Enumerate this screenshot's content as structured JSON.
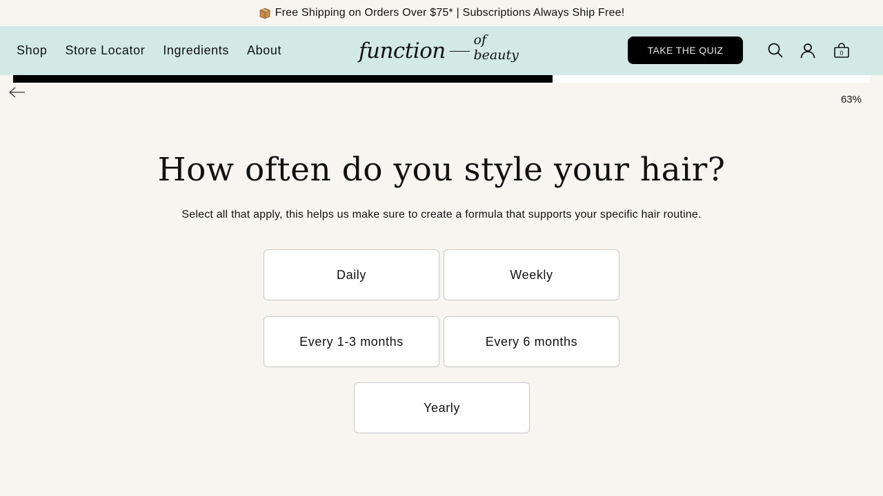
{
  "announcement": {
    "icon": "package-icon",
    "text": "Free Shipping on Orders Over $75* | Subscriptions Always Ship Free!"
  },
  "nav": {
    "links": [
      "Shop",
      "Store Locator",
      "Ingredients",
      "About"
    ],
    "logo_main": "function",
    "logo_sub": "of beauty",
    "quiz_button": "TAKE THE QUIZ",
    "cart_count": "0",
    "icons": [
      "search-icon",
      "account-icon",
      "cart-icon"
    ],
    "background": "#d3e9e6"
  },
  "progress": {
    "percent": 63,
    "label": "63%"
  },
  "question": {
    "title": "How often do you style your hair?",
    "subtitle": "Select all that apply, this helps us make sure to create a formula that supports your specific hair routine.",
    "options": [
      "Daily",
      "Weekly",
      "Every 1-3 months",
      "Every 6 months",
      "Yearly"
    ]
  },
  "colors": {
    "page_background": "#f8f4ef",
    "accent": "#000000",
    "option_background": "#ffffff"
  }
}
